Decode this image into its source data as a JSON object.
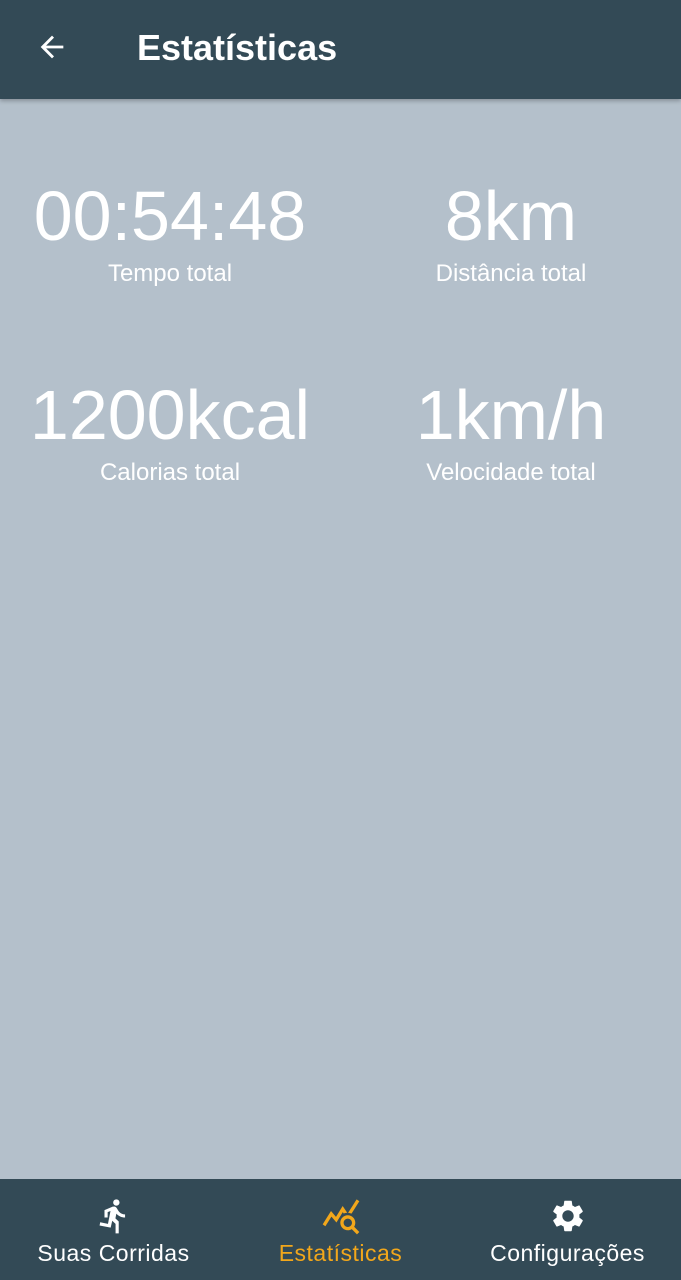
{
  "app_bar": {
    "title": "Estatísticas",
    "back_icon": "arrow-left-icon"
  },
  "stats": [
    {
      "value": "00:54:48",
      "label": "Tempo total"
    },
    {
      "value": "8km",
      "label": "Distância total"
    },
    {
      "value": "1200kcal",
      "label": "Calorias total"
    },
    {
      "value": "1km/h",
      "label": "Velocidade total"
    }
  ],
  "bottom_nav": {
    "items": [
      {
        "label": "Suas Corridas",
        "icon": "running-person-icon",
        "active": false
      },
      {
        "label": "Estatísticas",
        "icon": "chart-search-icon",
        "active": true
      },
      {
        "label": "Configurações",
        "icon": "gear-icon",
        "active": false
      }
    ]
  },
  "colors": {
    "bar_background": "#334a56",
    "content_background": "#b4c0cb",
    "accent": "#f2a71b",
    "text": "#ffffff"
  }
}
